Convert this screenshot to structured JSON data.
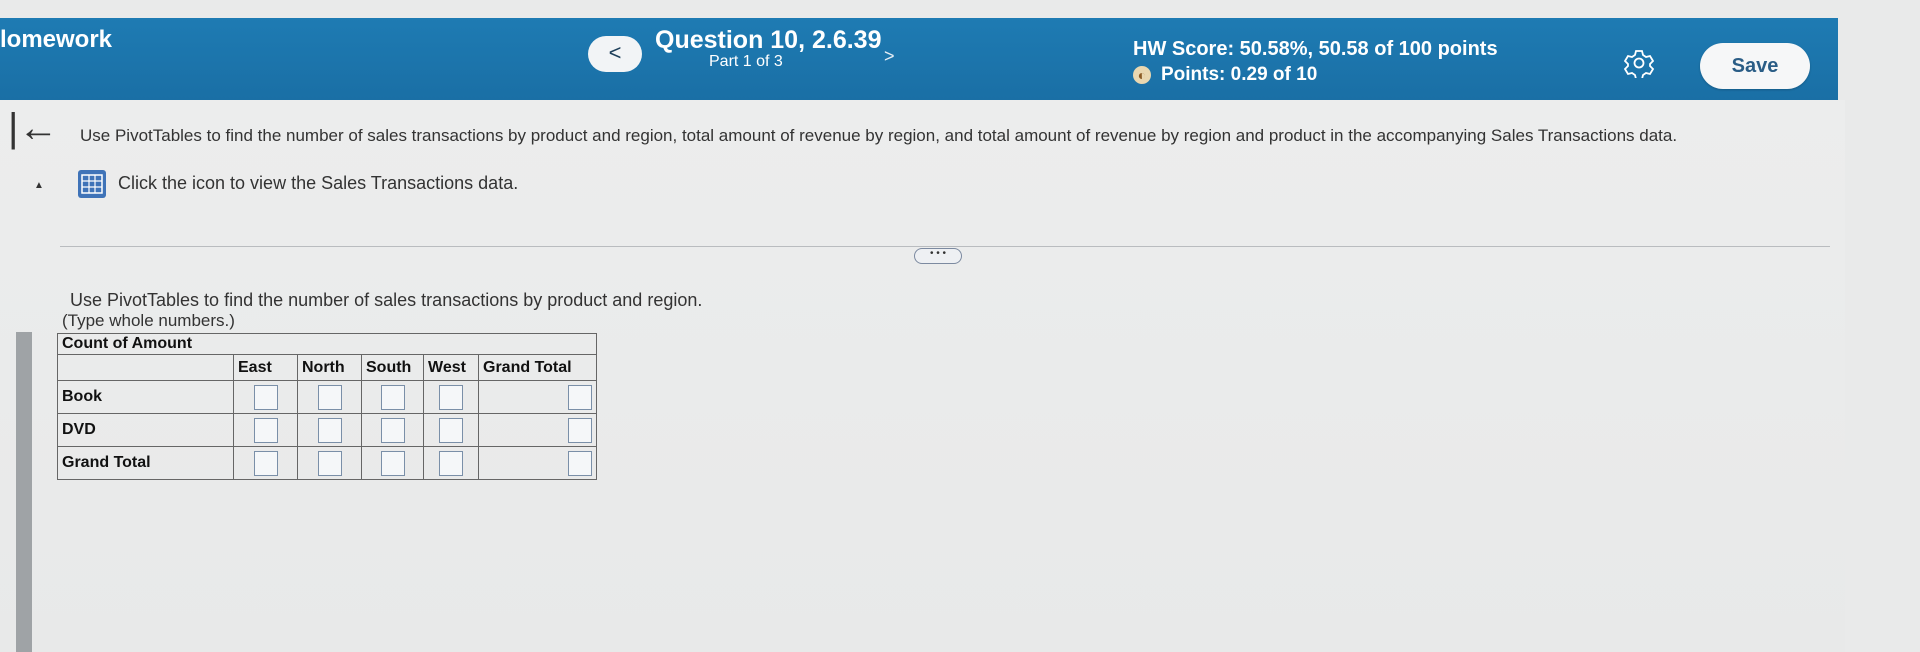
{
  "header": {
    "title": "lomework",
    "question_title": "Question 10, 2.6.39",
    "part": "Part 1 of 3",
    "hw_score": "HW Score: 50.58%, 50.58 of 100 points",
    "points": "Points: 0.29 of 10",
    "prev_label": "<",
    "next_label": ">",
    "save_label": "Save",
    "points_icon": "partial-credit-icon",
    "accent": "#1e7bb3"
  },
  "content": {
    "back_label": "|←",
    "intro": "Use PivotTables to find the number of sales transactions by product and region, total amount of revenue by region, and total amount of revenue by region and product in the accompanying Sales Transactions data.",
    "click_text": "Click the icon to view the Sales Transactions data.",
    "dots_label": "• • •",
    "instruction": "Use PivotTables to find the number of sales transactions by product and region.",
    "hint": "(Type whole numbers.)"
  },
  "table": {
    "caption": "Count of Amount",
    "columns": [
      "East",
      "North",
      "South",
      "West",
      "Grand Total"
    ],
    "rows": [
      {
        "label": "Book",
        "values": [
          "",
          "",
          "",
          "",
          ""
        ]
      },
      {
        "label": "DVD",
        "values": [
          "",
          "",
          "",
          "",
          ""
        ]
      },
      {
        "label": "Grand Total",
        "values": [
          "",
          "",
          "",
          "",
          ""
        ]
      }
    ]
  }
}
